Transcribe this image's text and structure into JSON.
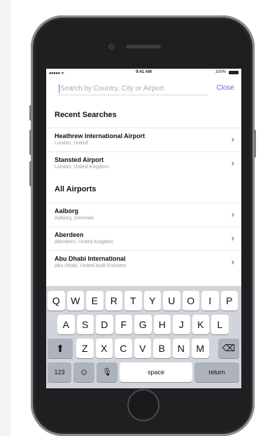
{
  "status_bar": {
    "signal": "●●●●● ᯤ",
    "time": "9:41 AM",
    "battery": "100%"
  },
  "search": {
    "placeholder": "Search by Country, City or Airport",
    "close_label": "Close"
  },
  "recent": {
    "title": "Recent Searches",
    "items": [
      {
        "name": "Heathrew International Airport",
        "location": "London, United"
      },
      {
        "name": "Stansted Airport",
        "location": "London, United Kingdom"
      }
    ]
  },
  "all": {
    "title": "All Airports",
    "items": [
      {
        "name": "Aalborg",
        "location": "Aalborg, Denmark"
      },
      {
        "name": "Aberdeen",
        "location": "Aberdeen, United Kingdom"
      },
      {
        "name": "Abu Dhabi International",
        "location": "Abu Dhabi, United Arab Emirates"
      }
    ]
  },
  "keyboard": {
    "row1": [
      "Q",
      "W",
      "E",
      "R",
      "T",
      "Y",
      "U",
      "O",
      "I",
      "P"
    ],
    "row2": [
      "A",
      "S",
      "D",
      "F",
      "G",
      "H",
      "J",
      "K",
      "L"
    ],
    "row3": [
      "Z",
      "X",
      "C",
      "V",
      "B",
      "N",
      "M"
    ],
    "numbers_label": "123",
    "space_label": "space",
    "return_label": "return"
  },
  "icons": {
    "chevron": "›",
    "shift": "⬆",
    "backspace": "⌫",
    "emoji": "☺",
    "mic": "🎙"
  },
  "colors": {
    "accent": "#7b5cd6",
    "phone_body": "#1f1f21",
    "keyboard_bg": "#d1d4da"
  }
}
